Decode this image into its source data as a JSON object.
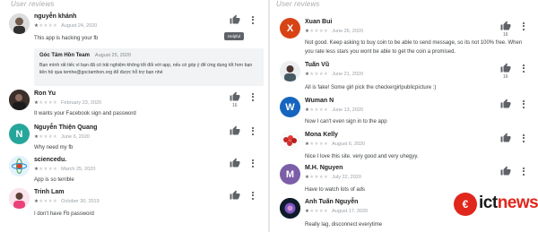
{
  "left": {
    "section_title": "User reviews",
    "tooltip": "Helpful",
    "reviews": [
      {
        "name": "nguyễn khánh",
        "date": "August 24, 2020",
        "rating": 1,
        "text": "This app is hacking your fb",
        "reply": {
          "name": "Góc Tâm Hồn Team",
          "date": "August 25, 2020",
          "text": "Bạn mình rất tiếc vì bạn đã có trải nghiệm không tốt đối với app, nếu có góp ý để ứng dụng tốt hơn bạn liên hệ qua temhe@goctamhon.org để được hỗ trợ bạn nhé"
        }
      },
      {
        "name": "Ron Yu",
        "date": "February 23, 2020",
        "rating": 1,
        "text": "It wants your Facebook sign and password",
        "likes": "16"
      },
      {
        "name": "Nguyễn Thiện Quang",
        "date": "June 6, 2020",
        "rating": 1,
        "text": "Why need my fb"
      },
      {
        "name": "sciencedu.",
        "date": "March 25, 2020",
        "rating": 1,
        "text": "App is so terrible"
      },
      {
        "name": "Trinh Lam",
        "date": "October 30, 2019",
        "rating": 1,
        "text": "I don't have Fb password"
      }
    ]
  },
  "right": {
    "section_title": "User reviews",
    "reviews": [
      {
        "name": "Xuan Bui",
        "date": "June 26, 2020",
        "rating": 1,
        "text_lines": [
          "Not good. Keep asking to buy coin to be able to send message, so its not 100% free. When",
          "you rate less stars you wont be able to get the coin a promised."
        ],
        "likes": "16",
        "initial": "X",
        "color": "#d84315"
      },
      {
        "name": "Tuấn Vũ",
        "date": "June 21, 2020",
        "rating": 1,
        "text_lines": [
          "All is fake! Some girl pick the checkergirlpublicpicture :)"
        ],
        "likes": "16"
      },
      {
        "name": "Wuman N",
        "date": "June 13, 2020",
        "rating": 1,
        "text_lines": [
          "Now I can't even sign in to the app"
        ],
        "initial": "W",
        "color": "#1565c0"
      },
      {
        "name": "Mona Kelly",
        "date": "August 6, 2020",
        "rating": 1,
        "text_lines": [
          "Nice I love this site. very good and very uhegyy."
        ]
      },
      {
        "name": "M.H. Nguyen",
        "date": "July 22, 2020",
        "rating": 1,
        "text_lines": [
          "Have to watch lots of ads"
        ],
        "initial": "M",
        "color": "#7b5ea7"
      },
      {
        "name": "Anh Tuấn Nguyễn",
        "date": "August 17, 2020",
        "rating": 1,
        "text_lines": [
          "Really lag, disconnect everytime"
        ]
      }
    ]
  },
  "logo": {
    "text_main": "ict",
    "text_accent": "news"
  },
  "colors": {
    "accent": "#e1261c",
    "star": "#5f6368"
  }
}
